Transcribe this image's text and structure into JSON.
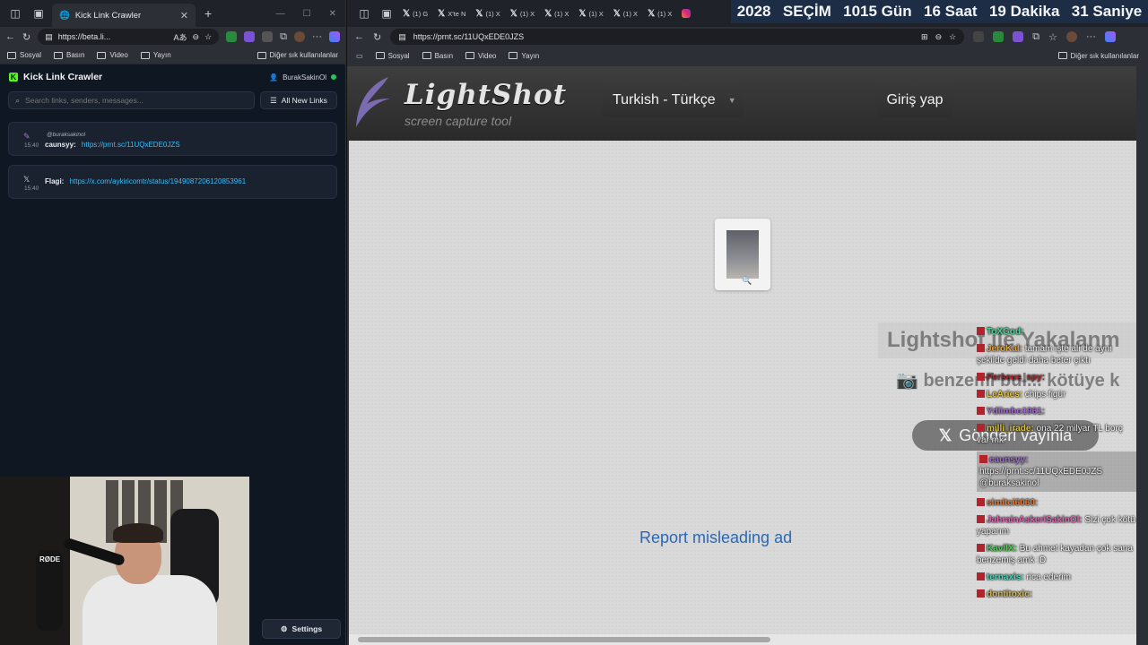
{
  "left": {
    "tab_title": "Kick Link Crawler",
    "url": "https://beta.li...",
    "bookmarks": [
      "Sosyal",
      "Basın",
      "Video",
      "Yayın"
    ],
    "bookmarks_other": "Diğer sık kullanılanlar",
    "app_title": "Kick Link Crawler",
    "user": "BurakSakinOl",
    "search_placeholder": "Search links, senders, messages...",
    "filter_label": "All New Links",
    "messages": [
      {
        "time": "15:40",
        "ref": "@buraksakinol",
        "sender": "caunsyy:",
        "link": "https://prnt.sc/11UQxEDE0JZS"
      },
      {
        "time": "15:40",
        "ref": "",
        "sender": "Flagi:",
        "link": "https://x.com/aykiricomtr/status/1949087206120853961"
      }
    ],
    "settings_label": "Settings",
    "mic_brand": "RØDE"
  },
  "right": {
    "tabs": [
      "(1) G",
      "X'te N",
      "(1) X",
      "(1) X",
      "(1) X",
      "(1) X",
      "(1) X",
      "(1) X"
    ],
    "countdown": [
      "2028",
      "SEÇİM",
      "1015 Gün",
      "16 Saat",
      "19 Dakika",
      "31 Saniye"
    ],
    "url": "https://prnt.sc/11UQxEDE0JZS",
    "bookmarks": [
      "Sosyal",
      "Basın",
      "Video",
      "Yayın"
    ],
    "bookmarks_other": "Diğer sık kullanılanlar",
    "logo": "LightShot",
    "tagline": "screen capture tool",
    "language": "Turkish - Türkçe",
    "login": "Giriş yap",
    "report": "Report misleading ad",
    "overlay_title": "Lightshot ile Yakalanm",
    "overlay_sub": "benzemi bul... kötüye k",
    "overlay_post": "Gönderi vayınla",
    "chat": [
      {
        "user": "ToXGod:",
        "msg": "",
        "color": "#4ad295"
      },
      {
        "user": "JeroKal:",
        "msg": "tamam işte ali de aynı şekilde geldi daha beter çıktı",
        "color": "#e0a23a"
      },
      {
        "user": "Perseus_spy:",
        "msg": "",
        "color": "#b3232e"
      },
      {
        "user": "LeAries:",
        "msg": "chips figür",
        "color": "#e0c24a"
      },
      {
        "user": "Ydiimbo1961:",
        "msg": "",
        "color": "#a56ad8"
      },
      {
        "user": "milli_irade:",
        "msg": "ona 22 milyar TL borç var mk",
        "color": "#d9c14a"
      },
      {
        "user": "caunsyy:",
        "msg": "https://prnt.sc/11UQxEDE0JZS @buraksakinol",
        "color": "#a56ad8"
      },
      {
        "user": "simitci6060:",
        "msg": "",
        "color": "#e07c3a"
      },
      {
        "user": "JahrainAskeriSakinOl:",
        "msg": "Sizi çok kötü yaparım",
        "color": "#d46ab0"
      },
      {
        "user": "KavilX:",
        "msg": "Bu ahmet kayadan çok sana benzemiş amk :D",
        "color": "#56c85a"
      },
      {
        "user": "ternaxis:",
        "msg": "rica ederim",
        "color": "#4ad2b5"
      },
      {
        "user": "dontitoxic:",
        "msg": "",
        "color": "#d1b54a"
      }
    ]
  }
}
